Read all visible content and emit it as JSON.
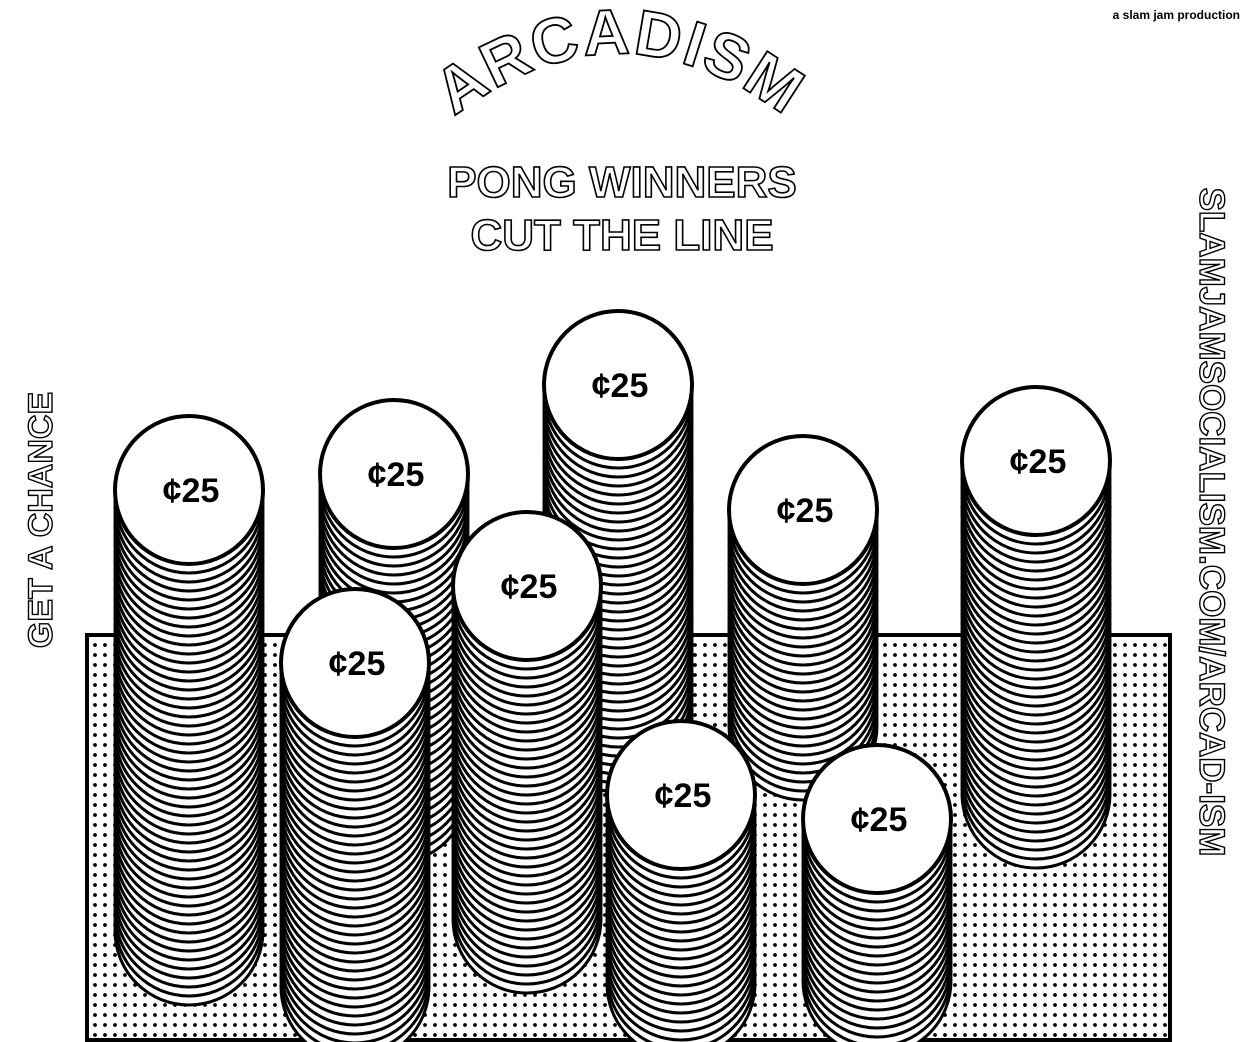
{
  "credit": "a slam jam production",
  "title": "ARCADISM",
  "headline": [
    "PONG WINNERS",
    "CUT THE LINE"
  ],
  "side_left": "GET A CHANCE",
  "side_right": "SLAMJAMSOCIALISM.COM/ARCAD-ISM",
  "coin_label": "¢25",
  "colors": {
    "ink": "#000000",
    "paper": "#ffffff"
  },
  "coin_stacks": [
    {
      "label": "¢25"
    },
    {
      "label": "¢25"
    },
    {
      "label": "¢25"
    },
    {
      "label": "¢25"
    },
    {
      "label": "¢25"
    },
    {
      "label": "¢25"
    },
    {
      "label": "¢25"
    },
    {
      "label": "¢25"
    },
    {
      "label": "¢25"
    }
  ]
}
